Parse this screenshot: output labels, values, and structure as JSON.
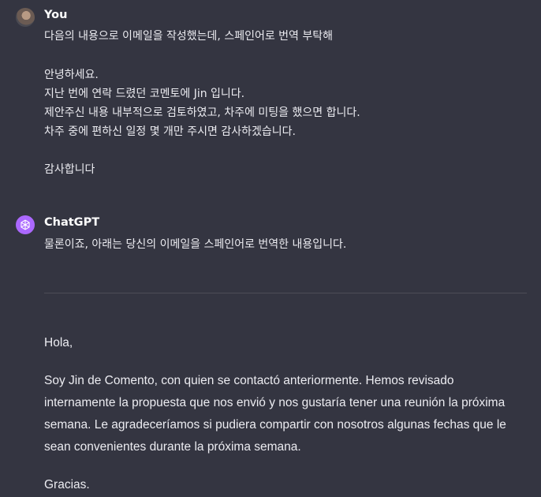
{
  "user_message": {
    "author": "You",
    "lines": [
      "다음의 내용으로 이메일을 작성했는데, 스페인어로 번역 부탁해",
      "안녕하세요.",
      "지난 번에 연락 드렸던 코멘토에 Jin 입니다.",
      "제안주신 내용 내부적으로 검토하였고, 차주에 미팅을 했으면 합니다.",
      "차주 중에 편하신 일정 몇 개만 주시면 감사하겠습니다.",
      "감사합니다"
    ]
  },
  "assistant_message": {
    "author": "ChatGPT",
    "intro": "물론이죠, 아래는 당신의 이메일을 스페인어로 번역한 내용입니다.",
    "translation_lines": [
      "Hola,",
      "Soy Jin de Comento, con quien se contactó anteriormente. Hemos revisado",
      "internamente la propuesta que nos envió y nos gustaría tener una reunión la próxima",
      "semana. Le agradeceríamos si pudiera compartir con nosotros algunas fechas que le",
      "sean convenientes durante la próxima semana.",
      "Gracias."
    ]
  },
  "colors": {
    "background": "#343541",
    "text": "#ececf1",
    "gpt_avatar": "#ab68ff"
  },
  "icons": {
    "user_avatar": "user-avatar-photo",
    "gpt_avatar": "openai-logo-icon"
  }
}
